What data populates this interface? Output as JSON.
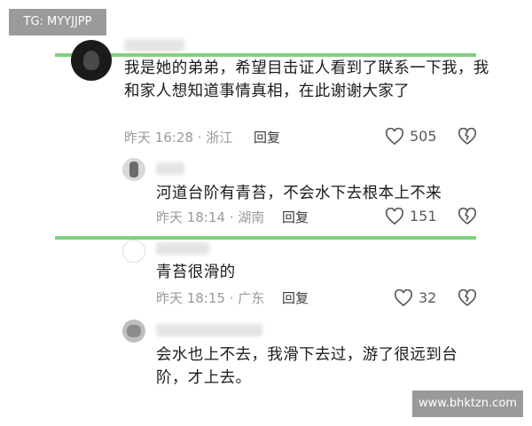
{
  "watermark": {
    "tag": "TG: MYYJJPP",
    "site": "www.bhktzn.com"
  },
  "highlight_color": "#7ed07e",
  "comments": [
    {
      "text": "我是她的弟弟，希望目击证人看到了联系一下我，我和家人想知道事情真相，在此谢谢大家了",
      "time": "昨天 16:28 · 浙江",
      "reply": "回复",
      "likes": "505"
    },
    {
      "text": "河道台阶有青苔，不会水下去根本上不来",
      "time": "昨天 18:14 · 湖南",
      "reply": "回复",
      "likes": "151"
    },
    {
      "text": "青苔很滑的",
      "time": "昨天 18:15 · 广东",
      "reply": "回复",
      "likes": "32"
    },
    {
      "text": "会水也上不去，我滑下去过，游了很远到台阶，才上去。"
    }
  ],
  "icons": {
    "like": "heart-outline-icon",
    "dislike": "broken-heart-icon"
  }
}
